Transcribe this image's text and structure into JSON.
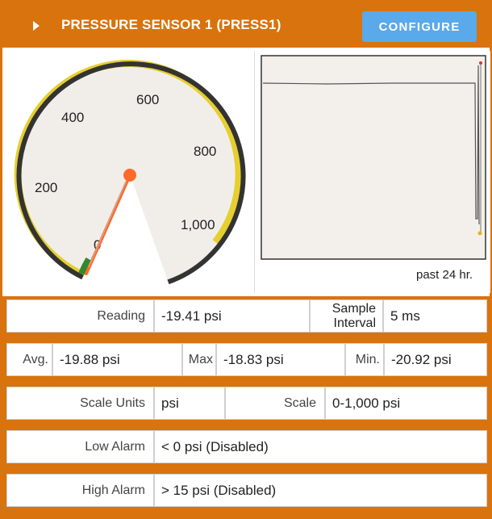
{
  "header": {
    "title": "PRESSURE SENSOR 1 (PRESS1)",
    "configure_label": "CONFIGURE"
  },
  "gauge": {
    "tick_labels": [
      "0",
      "200",
      "400",
      "600",
      "800",
      "1,000"
    ],
    "value": -19.41,
    "min": 0,
    "max": 1000
  },
  "trend": {
    "caption": "past 24 hr."
  },
  "readings": {
    "reading_label": "Reading",
    "reading_value": "-19.41 psi",
    "sample_label_1": "Sample",
    "sample_label_2": "Interval",
    "sample_value": "5 ms",
    "avg_label": "Avg.",
    "avg_value": "-19.88 psi",
    "max_label": "Max",
    "max_value": "-18.83 psi",
    "min_label": "Min.",
    "min_value": "-20.92 psi",
    "scale_units_label": "Scale Units",
    "scale_units_value": "psi",
    "scale_label": "Scale",
    "scale_value": "0-1,000 psi",
    "low_alarm_label": "Low Alarm",
    "low_alarm_value": "< 0 psi (Disabled)",
    "high_alarm_label": "High Alarm",
    "high_alarm_value": "> 15 psi (Disabled)"
  },
  "colors": {
    "header": "#d9730d",
    "button": "#5aa9ea",
    "gauge_band": "#e6cf2e",
    "needle": "#ff6a2a",
    "rim": "#333333"
  }
}
